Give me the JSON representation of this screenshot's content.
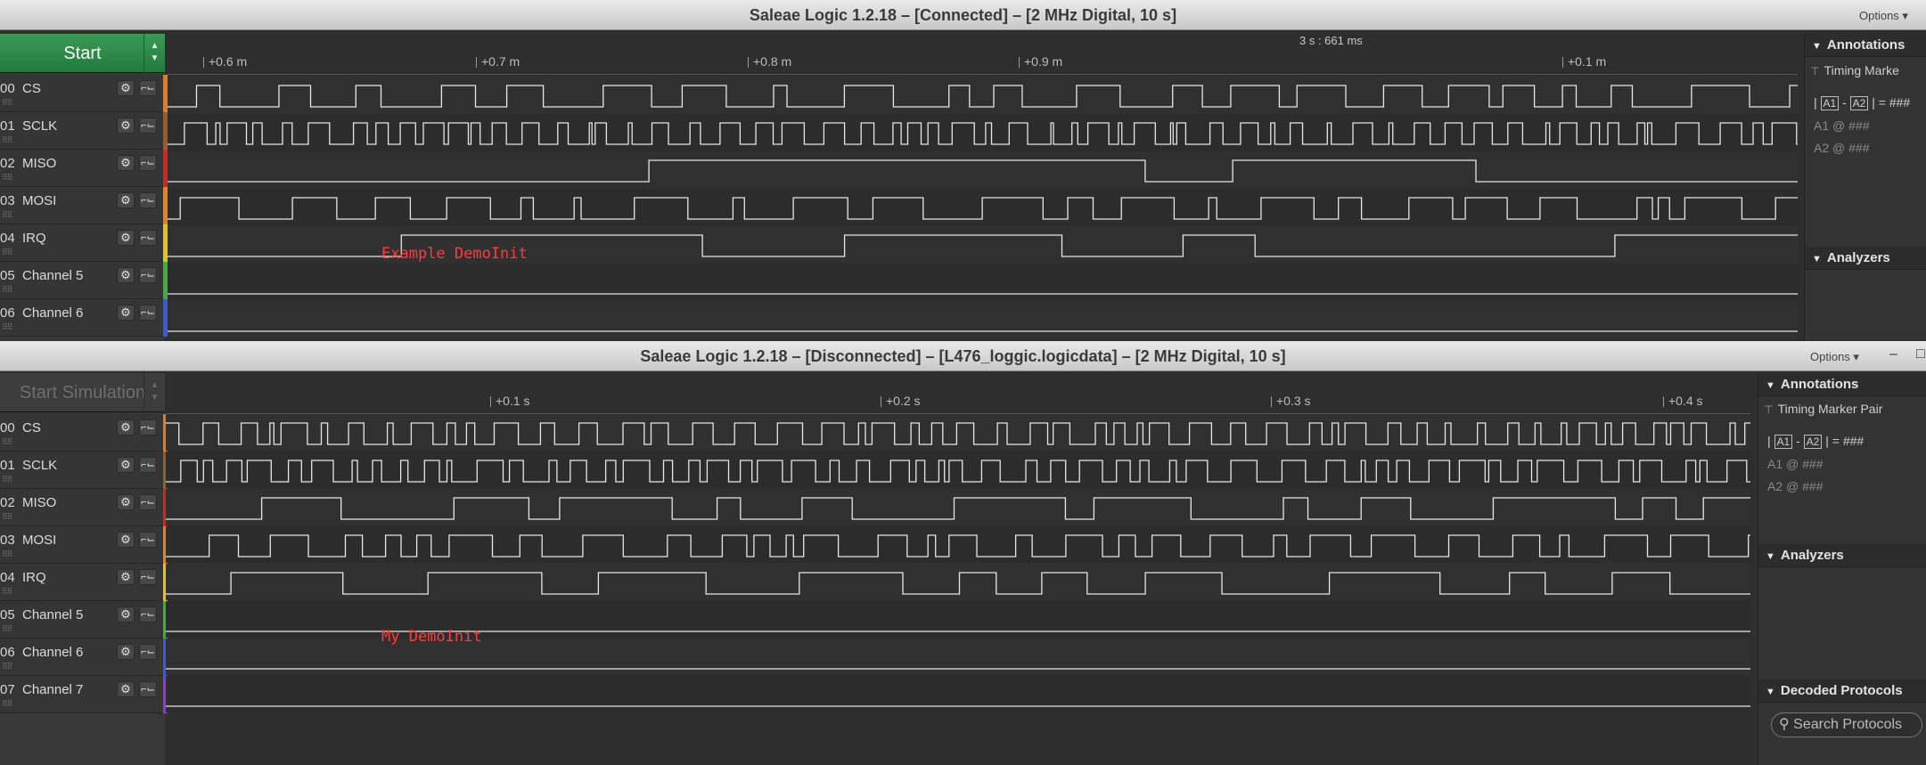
{
  "top": {
    "title": "Saleae Logic 1.2.18 – [Connected] – [2 MHz Digital, 10 s]",
    "options": "Options ▾",
    "start": "Start",
    "cursor_time": "3 s : 661 ms",
    "ruler_ticks": [
      "+0.6 m",
      "+0.7 m",
      "+0.8 m",
      "+0.9 m",
      "+0.1 m"
    ],
    "channels": [
      {
        "num": "00",
        "name": "CS",
        "color": "#e77a20"
      },
      {
        "num": "01",
        "name": "SCLK",
        "color": "#9b5a2a"
      },
      {
        "num": "02",
        "name": "MISO",
        "color": "#d42424"
      },
      {
        "num": "03",
        "name": "MOSI",
        "color": "#e8801c"
      },
      {
        "num": "04",
        "name": "IRQ",
        "color": "#e7c21f"
      },
      {
        "num": "05",
        "name": "Channel 5",
        "color": "#3fae3a"
      },
      {
        "num": "06",
        "name": "Channel 6",
        "color": "#3a58d8"
      }
    ],
    "annotation_note": "Example DemoInit",
    "panel": {
      "annotations": "Annotations",
      "timing_marker": "Timing Marke",
      "formula_a1": "A1",
      "formula_a2": "A2",
      "formula_rest": "| = ###",
      "a1_line": "A1  @  ###",
      "a2_line": "A2  @  ###",
      "analyzers": "Analyzers"
    }
  },
  "bottom": {
    "title": "Saleae Logic 1.2.18 – [Disconnected] – [L476_loggic.logicdata] – [2 MHz Digital, 10 s]",
    "options": "Options ▾",
    "min": "–",
    "max": "□",
    "start": "Start Simulation",
    "ruler_ticks": [
      "+0.1 s",
      "+0.2 s",
      "+0.3 s",
      "+0.4 s"
    ],
    "channels": [
      {
        "num": "00",
        "name": "CS",
        "color": "#e77a20"
      },
      {
        "num": "01",
        "name": "SCLK",
        "color": "#9b5a2a"
      },
      {
        "num": "02",
        "name": "MISO",
        "color": "#d42424"
      },
      {
        "num": "03",
        "name": "MOSI",
        "color": "#e8801c"
      },
      {
        "num": "04",
        "name": "IRQ",
        "color": "#e7c21f"
      },
      {
        "num": "05",
        "name": "Channel 5",
        "color": "#3fae3a"
      },
      {
        "num": "06",
        "name": "Channel 6",
        "color": "#3a58d8"
      },
      {
        "num": "07",
        "name": "Channel 7",
        "color": "#8a3ad8"
      }
    ],
    "annotation_note": "My DemoInit",
    "panel": {
      "annotations": "Annotations",
      "timing_marker": "Timing Marker Pair",
      "formula_a1": "A1",
      "formula_a2": "A2",
      "formula_rest": "| = ###",
      "a1_line": "A1  @  ###",
      "a2_line": "A2  @  ###",
      "analyzers": "Analyzers",
      "decoded": "Decoded Protocols",
      "search_placeholder": "Search Protocols"
    }
  }
}
